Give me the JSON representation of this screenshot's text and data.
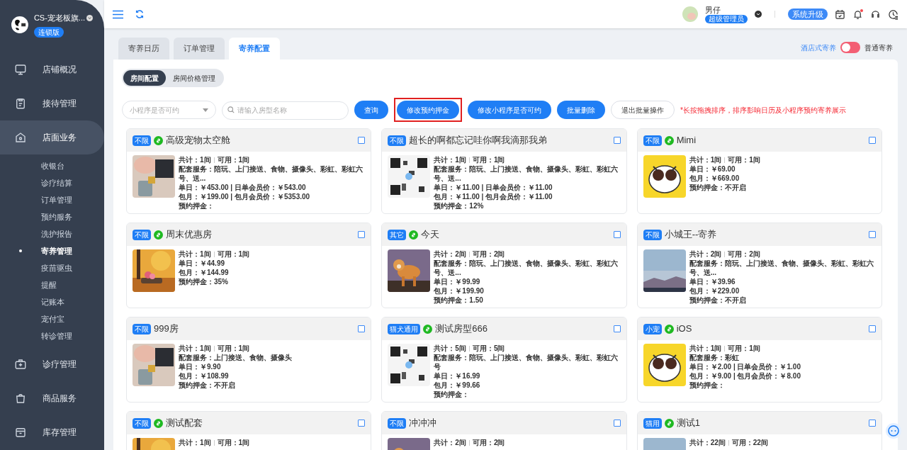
{
  "store": {
    "name": "CS-宠老板旗...",
    "badge": "连锁版"
  },
  "sidebar": {
    "items": [
      {
        "label": "店铺概况",
        "selected": false
      },
      {
        "label": "接待管理",
        "selected": false
      },
      {
        "label": "店面业务",
        "selected": true,
        "children": [
          {
            "label": "收银台",
            "selected": false
          },
          {
            "label": "诊疗结算",
            "selected": false
          },
          {
            "label": "订单管理",
            "selected": false
          },
          {
            "label": "预约服务",
            "selected": false
          },
          {
            "label": "洗护报告",
            "selected": false
          },
          {
            "label": "寄养管理",
            "selected": true
          },
          {
            "label": "疫苗驱虫",
            "selected": false
          },
          {
            "label": "提醒",
            "selected": false
          },
          {
            "label": "记账本",
            "selected": false
          },
          {
            "label": "宠付宝",
            "selected": false
          },
          {
            "label": "转诊管理",
            "selected": false
          }
        ]
      },
      {
        "label": "诊疗管理",
        "selected": false
      },
      {
        "label": "商品服务",
        "selected": false
      },
      {
        "label": "库存管理",
        "selected": false
      }
    ]
  },
  "user": {
    "name": "男仔",
    "role": "超级管理员",
    "upgrade": "系统升级",
    "notification": true
  },
  "tabs": [
    {
      "label": "寄养日历",
      "selected": false
    },
    {
      "label": "订单管理",
      "selected": false
    },
    {
      "label": "寄养配置",
      "selected": true
    }
  ],
  "mode_toggle": {
    "left": "酒店式寄养",
    "right": "普通寄养",
    "on": false
  },
  "subtabs": [
    {
      "label": "房间配置",
      "selected": true
    },
    {
      "label": "房间价格管理",
      "selected": false
    }
  ],
  "filter": {
    "select_placeholder": "小程序是否可约",
    "search_placeholder": "请输入房型名称"
  },
  "buttons": [
    {
      "label": "查询",
      "kind": "primary",
      "highlighted": false
    },
    {
      "label": "修改预约押金",
      "kind": "primary",
      "highlighted": true
    },
    {
      "label": "修改小程序是否可约",
      "kind": "primary",
      "highlighted": false
    },
    {
      "label": "批量删除",
      "kind": "primary",
      "highlighted": false
    },
    {
      "label": "退出批量操作",
      "kind": "plain",
      "highlighted": false
    }
  ],
  "hint": "*长按拖拽排序，排序影响日历及小程序预约寄养展示",
  "rooms": [
    {
      "tag": "不限",
      "miniprogram": true,
      "name": "高级宠物太空舱",
      "checked": false,
      "total": "共计：1间",
      "available": "可用：1间",
      "lines": [
        "配套服务：陪玩、上门接送、食物、摄像头、彩虹、彩虹六号、送...",
        "单日：￥453.00 | 日单会员价：￥543.00",
        "包月：￥199.00 | 包月会员价：￥5353.00",
        "预约押金："
      ]
    },
    {
      "tag": "不限",
      "miniprogram": false,
      "name": "超长的啊都忘记哇你啊我滴那我弟",
      "checked": false,
      "total": "共计：1间",
      "available": "可用：1间",
      "lines": [
        "配套服务：陪玩、上门接送、食物、摄像头、彩虹、彩虹六号、送...",
        "单日：￥11.00 | 日单会员价：￥11.00",
        "包月：￥11.00 | 包月会员价：￥11.00",
        "预约押金：12%"
      ]
    },
    {
      "tag": "不限",
      "miniprogram": true,
      "name": "Mimi",
      "checked": false,
      "total": "共计：1间",
      "available": "可用：1间",
      "lines": [
        "单日：￥69.00",
        "包月：￥669.00",
        "预约押金：不开启"
      ]
    },
    {
      "tag": "不限",
      "miniprogram": true,
      "name": "周末优惠房",
      "checked": false,
      "total": "共计：1间",
      "available": "可用：1间",
      "lines": [
        "单日：￥44.99",
        "包月：￥144.99",
        "预约押金：35%"
      ]
    },
    {
      "tag": "其它",
      "miniprogram": true,
      "name": "今天",
      "checked": false,
      "total": "共计：2间",
      "available": "可用：2间",
      "lines": [
        "配套服务：陪玩、上门接送、食物、摄像头、彩虹、彩虹六号、送...",
        "单日：￥99.99",
        "包月：￥199.90",
        "预约押金：1.50"
      ]
    },
    {
      "tag": "不限",
      "miniprogram": false,
      "name": "小城王--寄养",
      "checked": false,
      "total": "共计：2间",
      "available": "可用：2间",
      "lines": [
        "配套服务：陪玩、上门接送、食物、摄像头、彩虹、彩虹六号、送...",
        "单日：￥39.96",
        "包月：￥229.00",
        "预约押金：不开启"
      ]
    },
    {
      "tag": "不限",
      "miniprogram": false,
      "name": "999房",
      "checked": false,
      "total": "共计：1间",
      "available": "可用：1间",
      "lines": [
        "配套服务：上门接送、食物、摄像头",
        "单日：￥9.90",
        "包月：￥108.99",
        "预约押金：不开启"
      ]
    },
    {
      "tag": "猫犬通用",
      "miniprogram": true,
      "name": "测试房型666",
      "checked": false,
      "total": "共计：5间",
      "available": "可用：5间",
      "lines": [
        "配套服务：陪玩、上门接送、食物、摄像头、彩虹、彩虹六号",
        "单日：￥16.99",
        "包月：￥99.66",
        "预约押金："
      ]
    },
    {
      "tag": "小宠",
      "miniprogram": true,
      "name": "iOS",
      "checked": false,
      "total": "共计：1间",
      "available": "可用：1间",
      "lines": [
        "配套服务：彩虹",
        "单日：￥2.00 | 日单会员价：￥1.00",
        "包月：￥9.00 | 包月会员价：￥8.00",
        "预约押金："
      ]
    },
    {
      "tag": "不限",
      "miniprogram": true,
      "name": "测试配套",
      "checked": false,
      "total": "共计：1间",
      "available": "可用：1间"
    },
    {
      "tag": "不限",
      "miniprogram": false,
      "name": "冲冲冲",
      "checked": false,
      "total": "共计：2间",
      "available": "可用：2间"
    },
    {
      "tag": "猫用",
      "miniprogram": true,
      "name": "测试1",
      "checked": false,
      "total": "共计：22间",
      "available": "可用：22间"
    }
  ]
}
